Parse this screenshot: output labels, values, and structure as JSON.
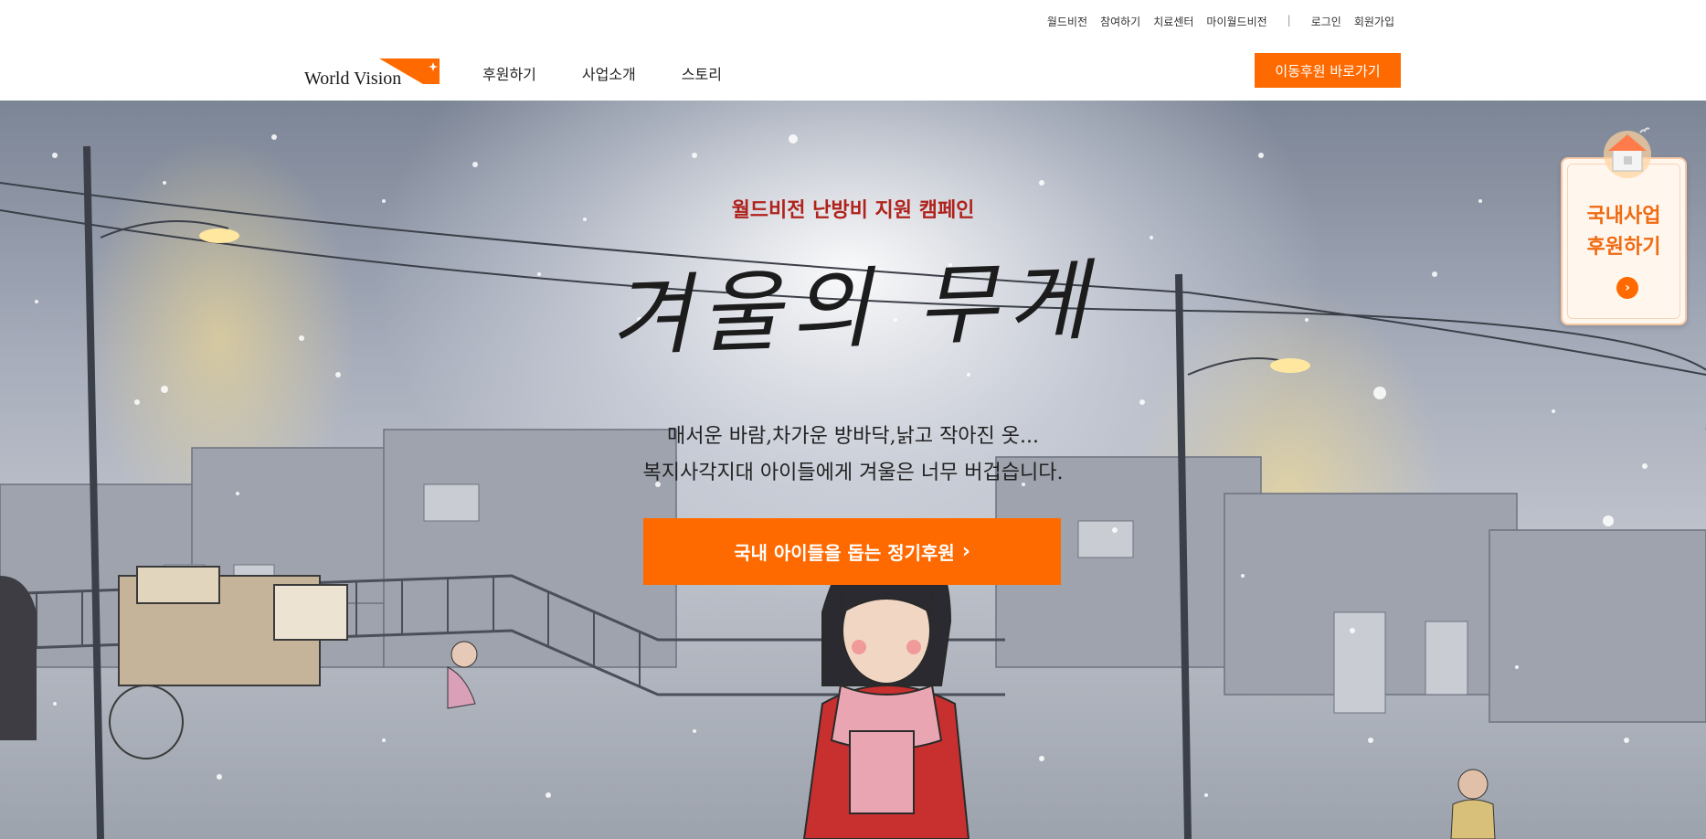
{
  "utility_links": [
    "월드비전",
    "참여하기",
    "치료센터",
    "마이월드비전"
  ],
  "auth_links": [
    "로그인",
    "회원가입"
  ],
  "logo_text": "World Vision",
  "nav": [
    "후원하기",
    "사업소개",
    "스토리"
  ],
  "top_cta": "이동후원 바로가기",
  "hero": {
    "subtitle": "월드비전 난방비 지원 캠페인",
    "title": "겨울의 무게",
    "desc_line1": "매서운 바람,차가운 방바닥,낡고 작아진 옷...",
    "desc_line2": "복지사각지대 아이들에게 겨울은 너무 버겁습니다.",
    "button": "국내 아이들을 돕는 정기후원"
  },
  "side_card": {
    "line1": "국내사업",
    "line2": "후원하기"
  },
  "colors": {
    "accent": "#ff6a00",
    "subtitle_red": "#b0221c",
    "side_text": "#f06a12"
  }
}
